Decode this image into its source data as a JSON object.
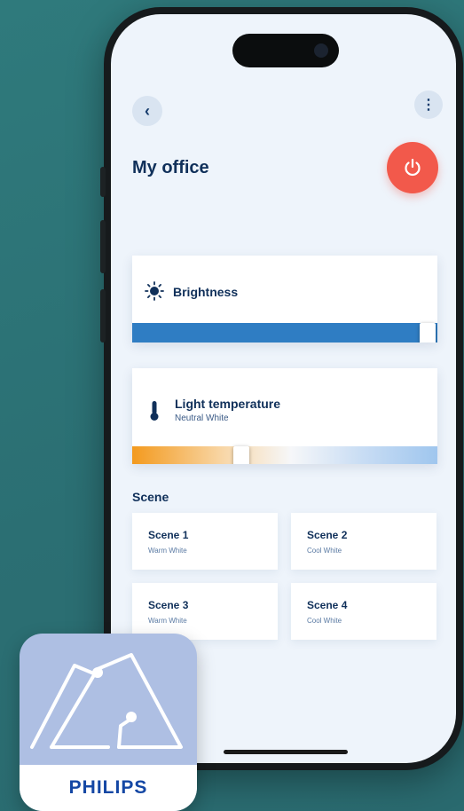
{
  "header": {
    "back_icon": "chevron-left-icon",
    "back_glyph": "‹",
    "menu_icon": "more-vertical-icon",
    "menu_glyph": "⋮",
    "title": "My office",
    "power_icon": "power-icon"
  },
  "brightness": {
    "label": "Brightness",
    "icon": "sun-icon",
    "level": 1.0
  },
  "temperature": {
    "label": "Light temperature",
    "value": "Neutral White",
    "icon": "thermometer-icon",
    "level": 0.35
  },
  "scenes": {
    "title": "Scene",
    "items": [
      {
        "name": "Scene 1",
        "sub": "Warm White"
      },
      {
        "name": "Scene 2",
        "sub": "Cool White"
      },
      {
        "name": "Scene 3",
        "sub": "Warm White"
      },
      {
        "name": "Scene 4",
        "sub": "Cool White"
      }
    ]
  },
  "app_icon": {
    "brand": "PHILIPS",
    "logo_icon": "mountain-logo-icon"
  },
  "colors": {
    "background": "#2f7a7c",
    "accent_blue": "#2f7dc3",
    "power_red": "#f2594b",
    "text_navy": "#10305a"
  }
}
